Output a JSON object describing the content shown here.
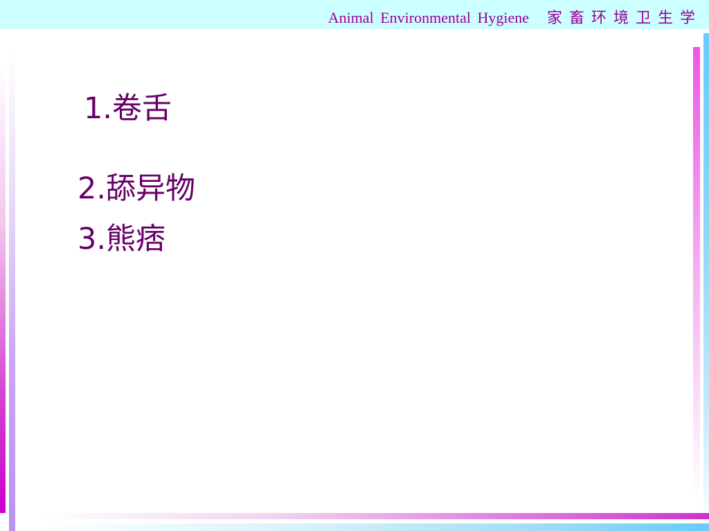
{
  "header": {
    "title_en": "Animal  Environmental  Hygiene",
    "title_cn": "家畜环境卫生学"
  },
  "content": {
    "items": [
      {
        "label": "1.卷舌"
      },
      {
        "label": "2.舔异物"
      },
      {
        "label": "3.熊痞"
      }
    ]
  },
  "colors": {
    "header_background": "#ccffff",
    "header_text": "#990099",
    "body_text": "#660066",
    "accent_magenta": "#cc00cc",
    "accent_violet": "#b993ee",
    "accent_blue": "#66ccff"
  }
}
